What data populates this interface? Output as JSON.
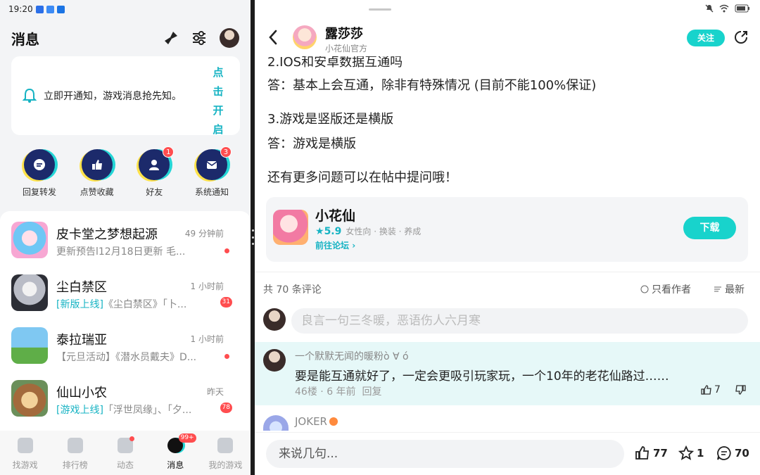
{
  "status": {
    "time": "19:20"
  },
  "left": {
    "title": "消息",
    "notice": {
      "text": "立即开通知，游戏消息抢先知。",
      "button": "点击开启"
    },
    "quick": [
      {
        "label": "回复转发",
        "icon": "comment-icon",
        "badge": ""
      },
      {
        "label": "点赞收藏",
        "icon": "thumb-up-icon",
        "badge": ""
      },
      {
        "label": "好友",
        "icon": "person-icon",
        "badge": "1"
      },
      {
        "label": "系统通知",
        "icon": "envelope-icon",
        "badge": "3"
      }
    ],
    "messages": [
      {
        "title": "皮卡堂之梦想起源",
        "time": "49 分钟前",
        "tag": "",
        "text": "更新预告l12月18日更新 毛...",
        "indicator": "dot"
      },
      {
        "title": "尘白禁区",
        "time": "1 小时前",
        "tag": "[新版上线]",
        "text": "《尘白禁区》「卜...",
        "indicator": "31"
      },
      {
        "title": "泰拉瑞亚",
        "time": "1 小时前",
        "tag": "",
        "text": "【元旦活动】《潜水员戴夫》D...",
        "indicator": "dot"
      },
      {
        "title": "仙山小农",
        "time": "昨天",
        "tag": "[游戏上线]",
        "text": "「浮世凤缘」、「夕...",
        "indicator": "78"
      }
    ],
    "tabs": [
      {
        "label": "找游戏",
        "badge": "",
        "dot": false
      },
      {
        "label": "排行榜",
        "badge": "",
        "dot": false
      },
      {
        "label": "动态",
        "badge": "",
        "dot": true
      },
      {
        "label": "消息",
        "badge": "99+",
        "dot": false,
        "active": true
      },
      {
        "label": "我的游戏",
        "badge": "",
        "dot": false
      }
    ]
  },
  "right": {
    "author": {
      "name": "露莎莎",
      "subtitle": "小花仙官方"
    },
    "follow_label": "关注",
    "article": [
      "2.IOS和安卓数据互通吗",
      "答：基本上会互通，除非有特殊情况 (目前不能100%保证)",
      "3.游戏是竖版还是横版",
      "答：游戏是横版",
      "还有更多问题可以在帖中提问哦！"
    ],
    "game": {
      "name": "小花仙",
      "score": "5.9",
      "tags": "女性向 · 换装 · 养成",
      "forum": "前往论坛",
      "download": "下载"
    },
    "comments_header": {
      "count": "共 70 条评论",
      "author_only": "只看作者",
      "sort": "最新"
    },
    "comment_placeholder": "良言一句三冬暖，恶语伤人六月寒",
    "comment": {
      "user": "一个默默无闻的暖粉ò ∀ ó",
      "text": "要是能互通就好了，一定会更吸引玩家玩，一个10年的老花仙路过……",
      "floor": "46楼",
      "time": "6 年前",
      "reply": "回复",
      "likes": "7"
    },
    "comment2_user": "JOKER",
    "bottom": {
      "say_placeholder": "来说几句...",
      "likes": "77",
      "stars": "1",
      "comments": "70"
    }
  },
  "colors": {
    "accent": "#18d3cc",
    "badge": "#ff4d4f"
  }
}
